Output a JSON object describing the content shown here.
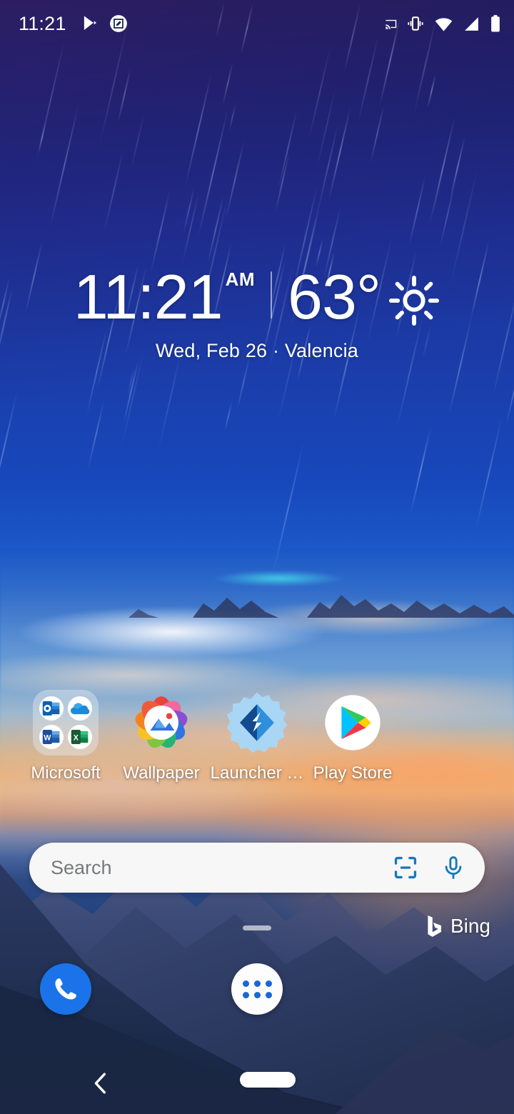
{
  "status_bar": {
    "time": "11:21",
    "left_icons": [
      "play-store-notification-icon",
      "screenshot-edit-notification-icon"
    ],
    "right_icons": [
      "cast-icon",
      "vibrate-icon",
      "wifi-icon",
      "cellular-signal-icon",
      "battery-icon"
    ]
  },
  "widget": {
    "time": "11:21",
    "am_pm": "AM",
    "temperature": "63°",
    "weather_icon": "sun-icon",
    "date_location": "Wed, Feb 26 · Valencia"
  },
  "apps": [
    {
      "label": "Microsoft",
      "icon": "microsoft-folder-icon",
      "type": "folder",
      "contents": [
        "outlook-icon",
        "onedrive-icon",
        "word-icon",
        "excel-icon"
      ]
    },
    {
      "label": "Wallpaper",
      "icon": "wallpaper-app-icon",
      "type": "app"
    },
    {
      "label": "Launcher …",
      "icon": "microsoft-launcher-settings-icon",
      "type": "app"
    },
    {
      "label": "Play Store",
      "icon": "play-store-icon",
      "type": "app"
    }
  ],
  "search": {
    "placeholder": "Search",
    "scan_icon": "scan-qr-icon",
    "mic_icon": "microphone-icon",
    "accent_color": "#1878b9"
  },
  "brand": {
    "name": "Bing",
    "icon": "bing-logo-icon"
  },
  "page_indicator": {
    "pages": 1,
    "current": 1
  },
  "dock": [
    {
      "label": "Phone",
      "icon": "phone-icon",
      "color": "#1a73e8"
    },
    {
      "label": "App drawer",
      "icon": "app-drawer-icon",
      "color": "#1967d2"
    }
  ],
  "nav_bar": {
    "back": "back-chevron-icon",
    "home": "home-gesture-pill"
  },
  "colors": {
    "accent_blue": "#1878b9",
    "dock_blue": "#1a73e8",
    "search_bg": "#f7f7f7",
    "text_white": "#ffffff"
  }
}
